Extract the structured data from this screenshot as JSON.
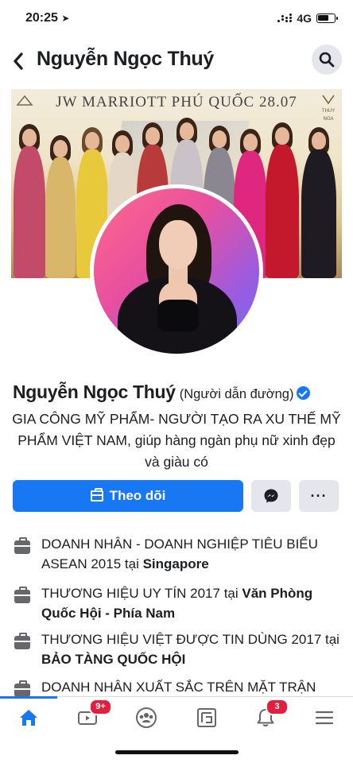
{
  "status_bar": {
    "time": "20:25",
    "network": "4G"
  },
  "header": {
    "title": "Nguyễn Ngọc Thuý",
    "back_glyph": "‹",
    "back_icon": "chevron-left-icon",
    "search_icon": "search-icon"
  },
  "cover": {
    "title": "JW MARRIOTT PHÚ QUỐC 28.07",
    "left_logo": "logo",
    "right_logo": "THUY NGA"
  },
  "profile": {
    "name": "Nguyễn Ngọc Thuý",
    "alternate_name": "(Người dẫn đường)",
    "verified": true,
    "bio": "GIA CÔNG MỸ PHẨM- NGƯỜI TẠO RA XU THẾ MỸ PHẨM VIỆT NAM, giúp hàng ngàn phụ nữ xinh đẹp và giàu có"
  },
  "actions": {
    "follow_label": "Theo dõi",
    "more_label": "···",
    "accent_color": "#1877f2"
  },
  "about": [
    {
      "text": "DOANH NHÂN - DOANH NGHIỆP TIÊU BIỂU ASEAN 2015 tại ",
      "place": "Singapore"
    },
    {
      "text": "THƯƠNG HIỆU UY TÍN 2017 tại ",
      "place": "Văn Phòng Quốc Hội - Phía Nam"
    },
    {
      "text": "THƯƠNG HIỆU VIỆT ĐƯỢC TIN DÙNG 2017 tại ",
      "place": "BẢO TÀNG QUỐC HỘI"
    },
    {
      "text": "DOANH NHÂN XUẤT SẮC TRÊN MẶT TRẬN",
      "place": ""
    }
  ],
  "tab_bar": {
    "tabs": [
      "home",
      "watch",
      "groups",
      "pages",
      "notifications",
      "menu"
    ],
    "watch_badge": "9+",
    "notifications_badge": "3"
  }
}
